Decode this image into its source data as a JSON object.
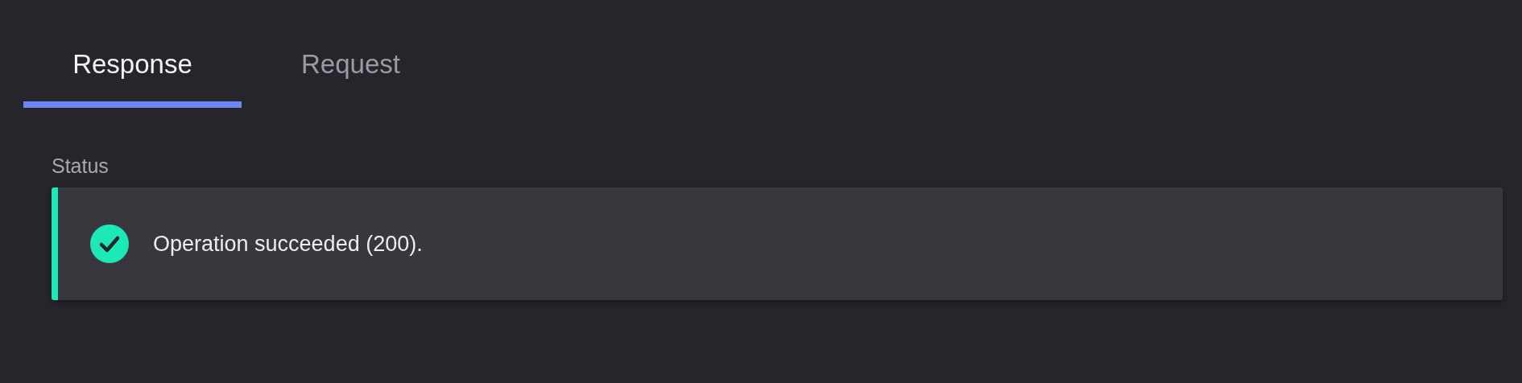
{
  "tabs": [
    {
      "label": "Response",
      "selected": true
    },
    {
      "label": "Request",
      "selected": false
    }
  ],
  "status": {
    "label": "Status",
    "message": "Operation succeeded (200).",
    "kind": "success"
  }
}
